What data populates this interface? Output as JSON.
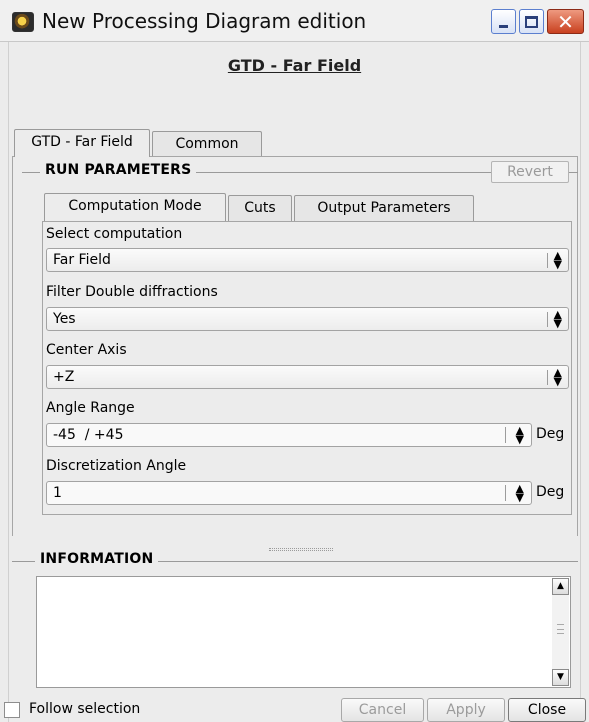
{
  "window": {
    "title": "New Processing Diagram edition",
    "minimize_icon": "minimize-icon",
    "maximize_icon": "maximize-icon",
    "close_icon": "close-icon",
    "close_color": "#c9401f"
  },
  "diagram_title": "GTD - Far Field",
  "outer_tabs": [
    {
      "label": "GTD - Far Field",
      "active": true
    },
    {
      "label": "Common",
      "active": false
    }
  ],
  "run_parameters": {
    "title": "RUN PARAMETERS",
    "revert_label": "Revert",
    "tabs": [
      {
        "label": "Computation Mode",
        "active": true
      },
      {
        "label": "Cuts",
        "active": false
      },
      {
        "label": "Output Parameters",
        "active": false
      }
    ],
    "fields": {
      "select_computation": {
        "label": "Select computation",
        "value": "Far Field"
      },
      "filter_double_diffractions": {
        "label": "Filter Double diffractions",
        "value": "Yes"
      },
      "center_axis": {
        "label": "Center Axis",
        "value": "+Z"
      },
      "angle_range": {
        "label": "Angle Range",
        "value": "-45  / +45",
        "unit": "Deg"
      },
      "discretization_angle": {
        "label": "Discretization Angle",
        "value": "1",
        "unit": "Deg"
      }
    }
  },
  "information": {
    "title": "INFORMATION",
    "content": ""
  },
  "footer": {
    "follow_selection_label": "Follow selection",
    "follow_selection_checked": false,
    "cancel_label": "Cancel",
    "apply_label": "Apply",
    "close_label": "Close"
  }
}
